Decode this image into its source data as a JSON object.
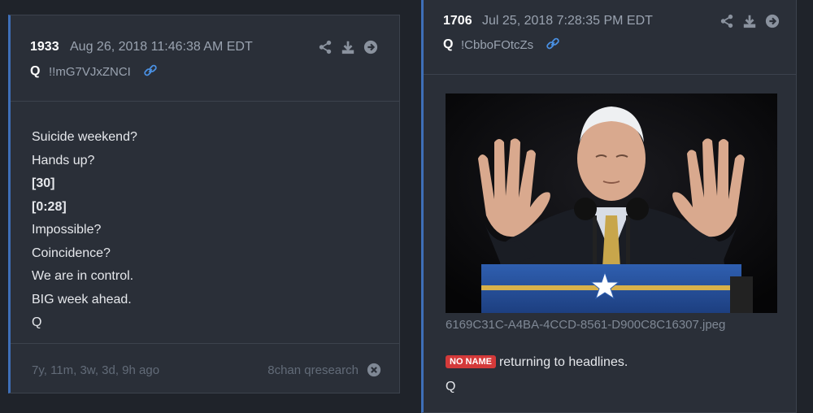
{
  "left_post": {
    "number": "1933",
    "date": "Aug 26, 2018 11:46:38 AM EDT",
    "author": "Q",
    "tripcode": "!!mG7VJxZNCI",
    "lines": [
      {
        "text": "Suicide weekend?",
        "bold": false
      },
      {
        "text": "Hands up?",
        "bold": false
      },
      {
        "text": "[30]",
        "bold": true
      },
      {
        "text": "[0:28]",
        "bold": true
      },
      {
        "text": "Impossible?",
        "bold": false
      },
      {
        "text": "Coincidence?",
        "bold": false
      },
      {
        "text": "We are in control.",
        "bold": false
      },
      {
        "text": "BIG week ahead.",
        "bold": false
      },
      {
        "text": "Q",
        "bold": false
      }
    ],
    "footer": {
      "ago": "7y, 11m, 3w, 3d, 9h ago",
      "board": "8chan qresearch"
    }
  },
  "right_post": {
    "number": "1706",
    "date": "Jul 25, 2018 7:28:35 PM EDT",
    "author": "Q",
    "tripcode": "!CbboFOtcZs",
    "filename": "6169C31C-A4BA-4CCD-8561-D900C8C16307.jpeg",
    "badge": "NO NAME",
    "message": "returning to headlines.",
    "signature": "Q"
  },
  "icons": [
    "share-icon",
    "download-icon",
    "arrow-right-circle-icon",
    "link-icon",
    "close-circle-icon"
  ],
  "colors": {
    "accent": "#3e6fb8",
    "badge": "#d43a3a",
    "link": "#4a90e2"
  }
}
